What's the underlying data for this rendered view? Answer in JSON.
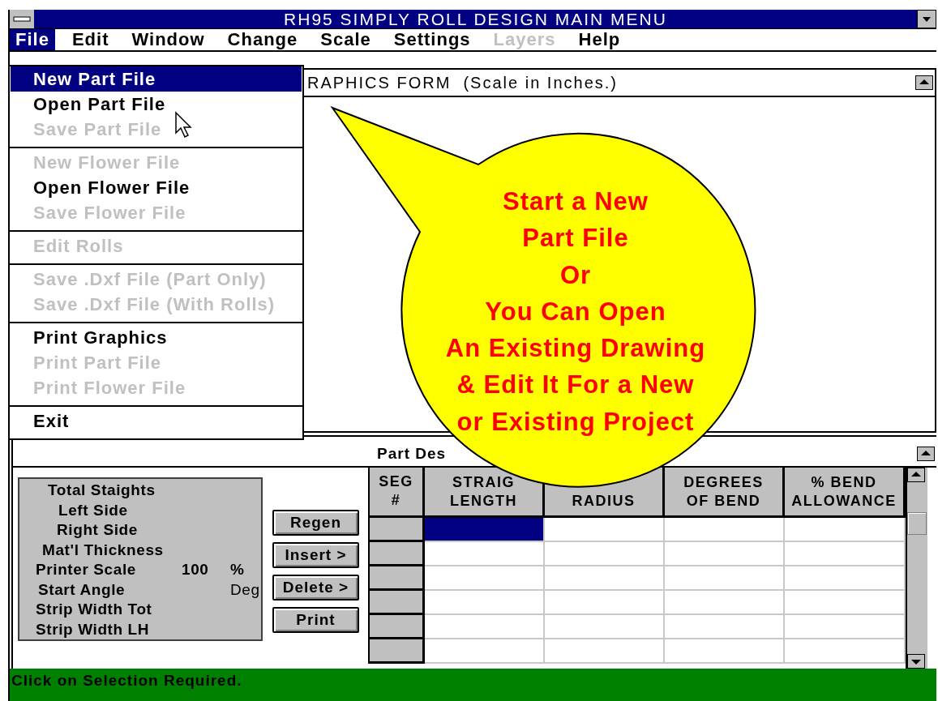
{
  "window": {
    "title": "RH95 SIMPLY ROLL DESIGN MAIN MENU"
  },
  "menu_bar": [
    {
      "label": "File",
      "selected": true,
      "disabled": false
    },
    {
      "label": "Edit",
      "selected": false,
      "disabled": false
    },
    {
      "label": "Window",
      "selected": false,
      "disabled": false
    },
    {
      "label": "Change",
      "selected": false,
      "disabled": false
    },
    {
      "label": "Scale",
      "selected": false,
      "disabled": false
    },
    {
      "label": "Settings",
      "selected": false,
      "disabled": false
    },
    {
      "label": "Layers",
      "selected": false,
      "disabled": true
    },
    {
      "label": "Help",
      "selected": false,
      "disabled": false
    }
  ],
  "file_menu": {
    "groups": [
      [
        {
          "label": "New Part File",
          "selected": true,
          "disabled": false
        },
        {
          "label": "Open Part File",
          "selected": false,
          "disabled": false
        },
        {
          "label": "Save Part File",
          "selected": false,
          "disabled": true
        }
      ],
      [
        {
          "label": "New Flower File",
          "selected": false,
          "disabled": true
        },
        {
          "label": "Open Flower File",
          "selected": false,
          "disabled": false
        },
        {
          "label": "Save Flower File",
          "selected": false,
          "disabled": true
        }
      ],
      [
        {
          "label": "Edit Rolls",
          "selected": false,
          "disabled": true
        }
      ],
      [
        {
          "label": "Save .Dxf File (Part Only)",
          "selected": false,
          "disabled": true
        },
        {
          "label": "Save .Dxf File (With Rolls)",
          "selected": false,
          "disabled": true
        }
      ],
      [
        {
          "label": "Print Graphics",
          "selected": false,
          "disabled": false
        },
        {
          "label": "Print Part File",
          "selected": false,
          "disabled": true
        },
        {
          "label": "Print Flower File",
          "selected": false,
          "disabled": true
        }
      ],
      [
        {
          "label": "Exit",
          "selected": false,
          "disabled": false
        }
      ]
    ]
  },
  "graphics_window": {
    "title": "RAPHICS FORM  (Scale in Inches.)"
  },
  "callout": {
    "lines": [
      "Start a New",
      "Part File",
      "Or",
      "You Can Open",
      "An Existing Drawing",
      "& Edit It For a New",
      "or Existing Project"
    ]
  },
  "part_design_window": {
    "title": "Part Des",
    "fields": [
      {
        "label": "Total Staights"
      },
      {
        "label": "Left Side"
      },
      {
        "label": "Right Side"
      },
      {
        "label": "Mat'l Thickness"
      },
      {
        "label": "Printer Scale",
        "value": "100",
        "unit": "%"
      },
      {
        "label": "Start Angle",
        "unit": "Deg"
      },
      {
        "label": "Strip Width Tot"
      },
      {
        "label": "Strip Width LH"
      }
    ],
    "buttons": [
      "Regen",
      "Insert >",
      "Delete >",
      "Print"
    ],
    "table": {
      "columns": [
        {
          "lines": [
            "SEG",
            "#"
          ]
        },
        {
          "lines": [
            "STRAIG",
            "LENGTH"
          ]
        },
        {
          "lines": [
            "RADIUS"
          ]
        },
        {
          "lines": [
            "DEGREES",
            "OF BEND"
          ]
        },
        {
          "lines": [
            "% BEND",
            "ALLOWANCE"
          ]
        }
      ],
      "rows": [
        {
          "cells": [
            {
              "selected": true
            },
            {
              "selected": false
            },
            {
              "selected": false
            },
            {
              "selected": false
            }
          ]
        },
        {
          "cells": [
            {
              "selected": false
            },
            {
              "selected": false
            },
            {
              "selected": false
            },
            {
              "selected": false
            }
          ]
        },
        {
          "cells": [
            {
              "selected": false
            },
            {
              "selected": false
            },
            {
              "selected": false
            },
            {
              "selected": false
            }
          ]
        },
        {
          "cells": [
            {
              "selected": false
            },
            {
              "selected": false
            },
            {
              "selected": false
            },
            {
              "selected": false
            }
          ]
        },
        {
          "cells": [
            {
              "selected": false
            },
            {
              "selected": false
            },
            {
              "selected": false
            },
            {
              "selected": false
            }
          ]
        },
        {
          "cells": [
            {
              "selected": false
            },
            {
              "selected": false
            },
            {
              "selected": false
            },
            {
              "selected": false
            }
          ]
        }
      ]
    }
  },
  "status_bar": {
    "text": "Click on Selection Required."
  }
}
